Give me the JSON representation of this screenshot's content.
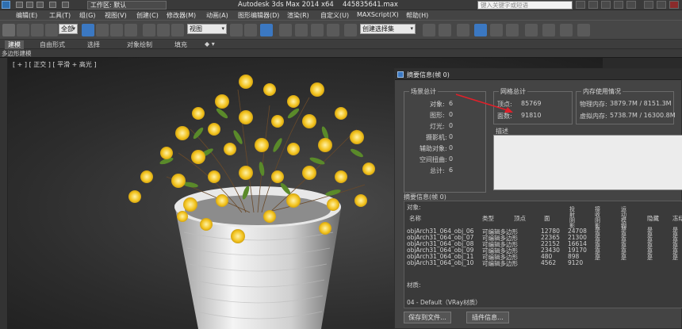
{
  "titlebar": {
    "workspace": "工作区: 默认",
    "app_title": "Autodesk 3ds Max  2014 x64",
    "file_name": "445835641.max",
    "search_placeholder": "键入关键字或短语"
  },
  "menu": [
    "编辑(E)",
    "工具(T)",
    "组(G)",
    "视图(V)",
    "创建(C)",
    "修改器(M)",
    "动画(A)",
    "图形编辑器(D)",
    "渲染(R)",
    "自定义(U)",
    "MAXScript(X)",
    "帮助(H)"
  ],
  "toolbar": {
    "filter_select": "全部",
    "view_select": "视图",
    "selection_set": "创建选择集"
  },
  "ribbon": {
    "tabs": [
      "建模",
      "自由形式",
      "选择",
      "对象绘制",
      "填充"
    ],
    "sub_label": "多边形建模"
  },
  "viewport": {
    "label": "[ + ] [ 正交 ] [ 平滑 + 高光 ]"
  },
  "dialog": {
    "title": "摘要信息(帧 0)",
    "scene_totals": {
      "title": "场景总计",
      "rows": [
        {
          "label": "对象:",
          "value": "6"
        },
        {
          "label": "图形:",
          "value": "0"
        },
        {
          "label": "灯光:",
          "value": "0"
        },
        {
          "label": "摄影机:",
          "value": "0"
        },
        {
          "label": "辅助对象:",
          "value": "0"
        },
        {
          "label": "空间扭曲:",
          "value": "0"
        },
        {
          "label": "总计:",
          "value": "6"
        }
      ]
    },
    "mesh_totals": {
      "title": "网格总计",
      "vertices_label": "顶点:",
      "vertices": "85769",
      "faces_label": "面数:",
      "faces": "91810"
    },
    "memory": {
      "title": "内存使用情况",
      "physical_label": "物理内存:",
      "physical": "3879.7M / 8151.3M",
      "virtual_label": "虚拟内存:",
      "virtual": "5738.7M / 16300.8M"
    },
    "description": {
      "title": "描述"
    },
    "summary": {
      "title": "摘要信息(帧 0)",
      "objects_label": "对象:",
      "columns": {
        "name": "名称",
        "type": "类型",
        "verts": "顶点",
        "faces": "面",
        "shadow_cast": "投射阴影",
        "shadow_recv": "接收阴影",
        "motion_blur": "运动模糊",
        "hidden": "隐藏",
        "frozen": "冻结"
      },
      "rows": [
        {
          "name": "objArch31_064_obj_06",
          "type": "可编辑多边形",
          "faces": "12780",
          "shadow": "24708"
        },
        {
          "name": "objArch31_064_obj_07",
          "type": "可编辑多边形",
          "faces": "22365",
          "shadow": "21300"
        },
        {
          "name": "objArch31_064_obj_08",
          "type": "可编辑多边形",
          "faces": "22152",
          "shadow": "16614"
        },
        {
          "name": "objArch31_064_obj_09",
          "type": "可编辑多边形",
          "faces": "23430",
          "shadow": "19170"
        },
        {
          "name": "objArch31_064_obj_11",
          "type": "可编辑多边形",
          "faces": "480",
          "shadow": "898"
        },
        {
          "name": "objArch31_064_obj_10",
          "type": "可编辑多边形",
          "faces": "4562",
          "shadow": "9120"
        }
      ],
      "flag_text": "是是是是是是",
      "materials_label": "材质:",
      "material_item": "04 - Default（VRay材质）"
    },
    "buttons": {
      "save": "保存到文件...",
      "plugins": "插件信息..."
    }
  },
  "colors": {
    "accent_arrow": "#e0202a",
    "flower": "#f2c21c",
    "leaf": "#5a8a2a"
  }
}
